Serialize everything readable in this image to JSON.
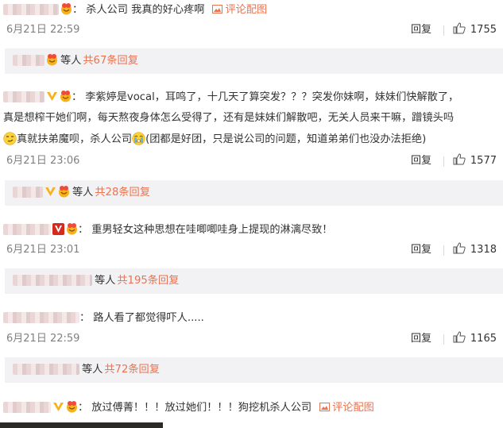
{
  "comments": [
    {
      "content": "杀人公司 我真的好心疼啊",
      "pic_link": "评论配图",
      "time": "6月21日 22:59",
      "reply": "回复",
      "likes": "1755",
      "sub": {
        "who": "等人",
        "count": "共67条回复"
      }
    },
    {
      "line1": "李紫婷是vocal，耳鸣了，十几天了算突发？？？突发你妹啊，妹妹们快解散了，",
      "line2": "真是想榨干她们啊，每天熬夜身体怎么受得了，还有是妹妹们解散吧，无关人员来干嘛，蹭镜头吗",
      "line3a": "真就扶弟魔呗，杀人公司",
      "line3b": "(团都是好团，只是说公司的问题，知道弟弟们也没办法拒绝)",
      "time": "6月21日 23:06",
      "reply": "回复",
      "likes": "1577",
      "sub": {
        "who": "等人",
        "count": "共28条回复"
      }
    },
    {
      "content": "重男轻女这种思想在哇唧唧哇身上提现的淋漓尽致！",
      "time": "6月21日 23:01",
      "reply": "回复",
      "likes": "1318",
      "sub": {
        "who": "等人",
        "count": "共195条回复"
      }
    },
    {
      "content": "路人看了都觉得吓人.....",
      "time": "6月21日 22:59",
      "reply": "回复",
      "likes": "1165",
      "sub": {
        "who": "等人",
        "count": "共72条回复"
      }
    },
    {
      "content": "放过傅菁！！！放过她们！！！狗挖机杀人公司",
      "pic_link": "评论配图"
    }
  ],
  "colors": {
    "accent": "#eb7350",
    "time": "#808080",
    "subbox_bg": "#f2f2f5",
    "text": "#333333"
  },
  "icons": {
    "like": "thumbs-up-icon",
    "picture": "picture-icon",
    "vip_badge": "vip-badge-icon",
    "verified": "verified-v-icon"
  }
}
